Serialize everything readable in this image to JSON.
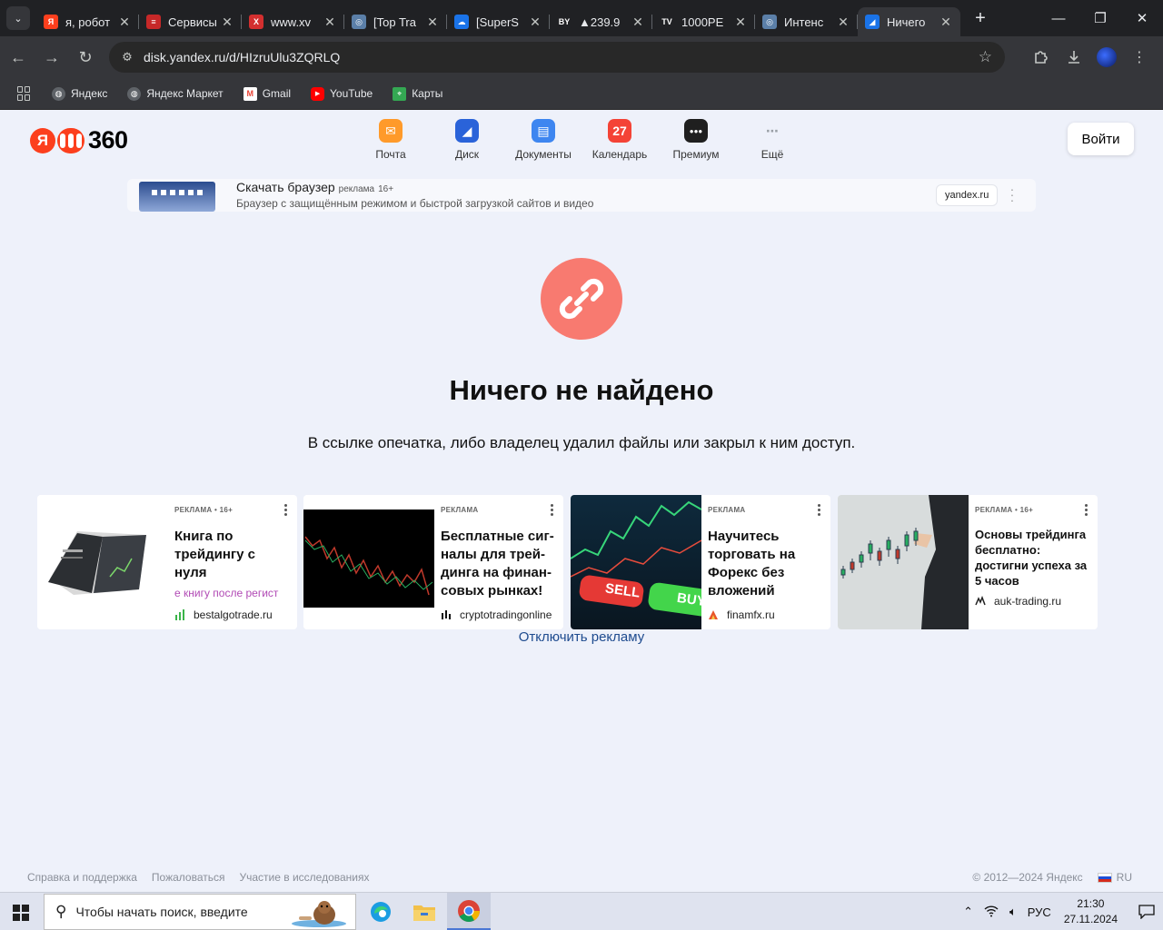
{
  "browser": {
    "tabs": [
      {
        "title": "я, робот",
        "favicon": "yandex-favicon",
        "color": "#fc3f1d",
        "glyph": "Я"
      },
      {
        "title": "Сервисы",
        "favicon": "service-favicon",
        "color": "#c62828",
        "glyph": "≡"
      },
      {
        "title": "www.xv",
        "favicon": "x-favicon",
        "color": "#d32f2f",
        "glyph": "X"
      },
      {
        "title": "[Top Tra",
        "favicon": "tracker-favicon",
        "color": "#5b7fa8",
        "glyph": "◎"
      },
      {
        "title": "[SuperS",
        "favicon": "cloud-favicon",
        "color": "#1a73e8",
        "glyph": "☁"
      },
      {
        "title": "▲239.9",
        "favicon": "bybit-favicon",
        "color": "#202124",
        "glyph": "BY"
      },
      {
        "title": "1000PE",
        "favicon": "tradingview-favicon",
        "color": "#202124",
        "glyph": "TV"
      },
      {
        "title": "Интенс",
        "favicon": "tracker-favicon",
        "color": "#5b7fa8",
        "glyph": "◎"
      },
      {
        "title": "Ничего",
        "favicon": "yandex-disk-favicon",
        "color": "#1a73e8",
        "glyph": "◢",
        "active": true
      }
    ],
    "url": "disk.yandex.ru/d/HIzruUlu3ZQRLQ",
    "bookmarks": [
      {
        "label": "Яндекс",
        "icon": "globe-icon"
      },
      {
        "label": "Яндекс Маркет",
        "icon": "globe-icon"
      },
      {
        "label": "Gmail",
        "icon": "gmail-icon"
      },
      {
        "label": "YouTube",
        "icon": "youtube-icon"
      },
      {
        "label": "Карты",
        "icon": "maps-icon"
      }
    ]
  },
  "header": {
    "logo_text": "360",
    "services": [
      {
        "label": "Почта",
        "icon": "mail-icon",
        "color": "#ff9a2a"
      },
      {
        "label": "Диск",
        "icon": "disk-icon",
        "color": "#2a63d9"
      },
      {
        "label": "Документы",
        "icon": "documents-icon",
        "color": "#3e86f0"
      },
      {
        "label": "Календарь",
        "icon": "calendar-icon",
        "color": "#f44336",
        "badge": "27"
      },
      {
        "label": "Премиум",
        "icon": "premium-icon",
        "color": "#1f1f1f"
      },
      {
        "label": "Ещё",
        "icon": "more-icon",
        "color": "#9aa0a6"
      }
    ],
    "login_label": "Войти"
  },
  "banner": {
    "title": "Скачать браузер",
    "ad_label": "реклама",
    "age": "16+",
    "description": "Браузер с защищённым режимом и быстрой загрузкой сайтов и видео",
    "domain": "yandex.ru"
  },
  "error": {
    "title": "Ничего не найдено",
    "message": "В ссылке опечатка, либо владелец удалил файлы или закрыл к ним доступ."
  },
  "ads": [
    {
      "meta": "РЕКЛАМА • 16+",
      "title": "Книга по трейдингу с нуля",
      "extra": "е книгу после регист",
      "domain": "bestalgotrade.ru"
    },
    {
      "meta": "РЕКЛАМА",
      "title": "Бесплатные сиг-налы для трей-динга на финан-совых рынках!",
      "domain": "cryptotradingonline"
    },
    {
      "meta": "РЕКЛАМА",
      "title": "Научитесь торговать на Форекс без вложений",
      "domain": "finamfx.ru",
      "img_labels": [
        "SELL",
        "BUY"
      ]
    },
    {
      "meta": "РЕКЛАМА • 16+",
      "title": "Основы трейдинга бесплатно: достигни успеха за 5 часов",
      "domain": "auk-trading.ru"
    }
  ],
  "disable_ads_label": "Отключить рекламу",
  "footer": {
    "links": [
      "Справка и поддержка",
      "Пожаловаться",
      "Участие в исследованиях"
    ],
    "copyright": "© 2012—2024 Яндекс",
    "lang": "RU"
  },
  "taskbar": {
    "search_placeholder": "Чтобы начать поиск, введите",
    "lang": "РУС",
    "time": "21:30",
    "date": "27.11.2024"
  }
}
